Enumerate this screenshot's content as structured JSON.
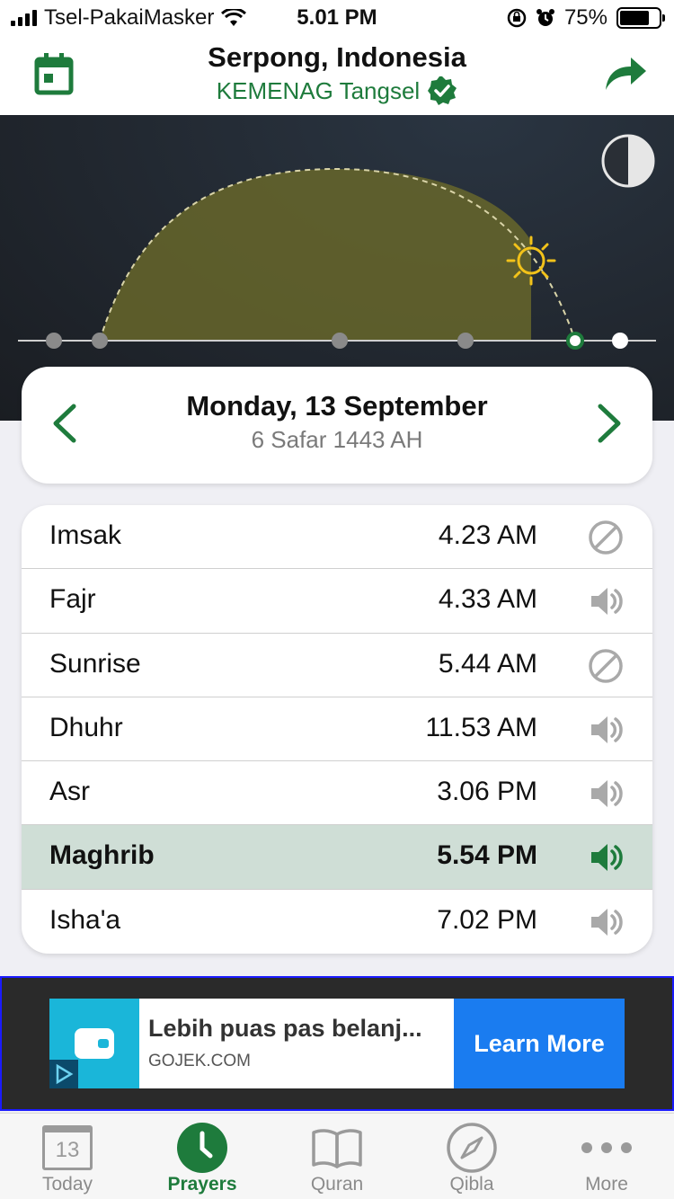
{
  "status_bar": {
    "carrier": "Tsel-PakaiMasker",
    "time": "5.01 PM",
    "battery": "75%",
    "battery_level": 0.75
  },
  "header": {
    "location": "Serpong, Indonesia",
    "authority": "KEMENAG Tangsel",
    "icons": {
      "left": "calendar-icon",
      "right": "share-icon",
      "verified": "verified-check-icon"
    }
  },
  "sky": {
    "icons": {
      "sun": "sun-icon",
      "theme": "half-circle-icon"
    },
    "colors": {
      "arc_fill": "#6b6a2a",
      "marker_active": "#1e7b3c"
    }
  },
  "date": {
    "gregorian": "Monday, 13 September",
    "hijri": "6 Safar 1443 AH"
  },
  "prayers": [
    {
      "name": "Imsak",
      "time": "4.23 AM",
      "icon": "muted-icon",
      "active": false
    },
    {
      "name": "Fajr",
      "time": "4.33 AM",
      "icon": "speaker-icon",
      "active": false
    },
    {
      "name": "Sunrise",
      "time": "5.44 AM",
      "icon": "muted-icon",
      "active": false
    },
    {
      "name": "Dhuhr",
      "time": "11.53 AM",
      "icon": "speaker-icon",
      "active": false
    },
    {
      "name": "Asr",
      "time": "3.06 PM",
      "icon": "speaker-icon",
      "active": false
    },
    {
      "name": "Maghrib",
      "time": "5.54 PM",
      "icon": "speaker-icon",
      "active": true
    },
    {
      "name": "Isha'a",
      "time": "7.02 PM",
      "icon": "speaker-icon",
      "active": false
    }
  ],
  "ad": {
    "headline": "Lebih puas pas belanj...",
    "domain": "GOJEK.COM",
    "cta": "Learn More"
  },
  "tabs": [
    {
      "label": "Today",
      "icon": "calendar-day-icon",
      "day": "13",
      "active": false
    },
    {
      "label": "Prayers",
      "icon": "clock-icon",
      "active": true
    },
    {
      "label": "Quran",
      "icon": "book-icon",
      "active": false
    },
    {
      "label": "Qibla",
      "icon": "compass-icon",
      "active": false
    },
    {
      "label": "More",
      "icon": "more-dots-icon",
      "active": false
    }
  ],
  "colors": {
    "brand_green": "#1e7b3c",
    "active_row": "#cfded6",
    "ad_cta": "#1a7cf0"
  }
}
